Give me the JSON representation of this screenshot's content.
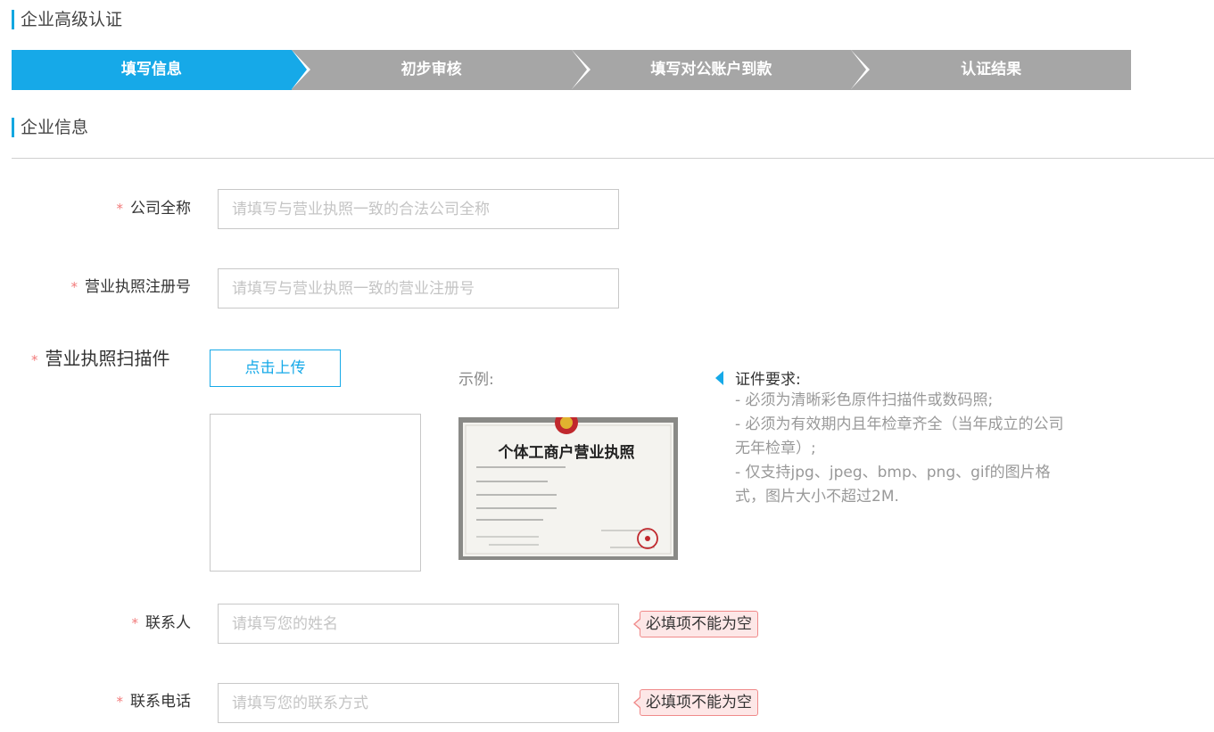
{
  "header": {
    "title": "企业高级认证"
  },
  "steps": [
    {
      "label": "填写信息",
      "active": true
    },
    {
      "label": "初步审核",
      "active": false
    },
    {
      "label": "填写对公账户到款",
      "active": false
    },
    {
      "label": "认证结果",
      "active": false
    }
  ],
  "section": {
    "title": "企业信息"
  },
  "form": {
    "required_mark": "*",
    "company_name": {
      "label": "公司全称",
      "placeholder": "请填写与营业执照一致的合法公司全称",
      "value": ""
    },
    "license_no": {
      "label": "营业执照注册号",
      "placeholder": "请填写与营业执照一致的营业注册号",
      "value": ""
    },
    "license_scan": {
      "label": "营业执照扫描件",
      "upload_label": "点击上传",
      "example_label": "示例:",
      "example_image": {
        "title_text": "个体工商户营业执照",
        "colors": {
          "paper": "#f4f3ef",
          "seal_red": "#c0282d",
          "ink": "#222222"
        }
      },
      "requirements_title": "证件要求:",
      "requirements": [
        "- 必须为清晰彩色原件扫描件或数码照;",
        "- 必须为有效期内且年检章齐全（当年成立的公司无年检章）;",
        "- 仅支持jpg、jpeg、bmp、png、gif的图片格式，图片大小不超过2M."
      ]
    },
    "contact_name": {
      "label": "联系人",
      "placeholder": "请填写您的姓名",
      "value": "",
      "error": "必填项不能为空"
    },
    "contact_phone": {
      "label": "联系电话",
      "placeholder": "请填写您的联系方式",
      "value": "",
      "error": "必填项不能为空"
    }
  },
  "colors": {
    "accent": "#16a9e8",
    "step_inactive": "#a6a6a6",
    "required": "#f27a7a",
    "error_bg": "#fde7e7",
    "error_border": "#f08a8a"
  }
}
